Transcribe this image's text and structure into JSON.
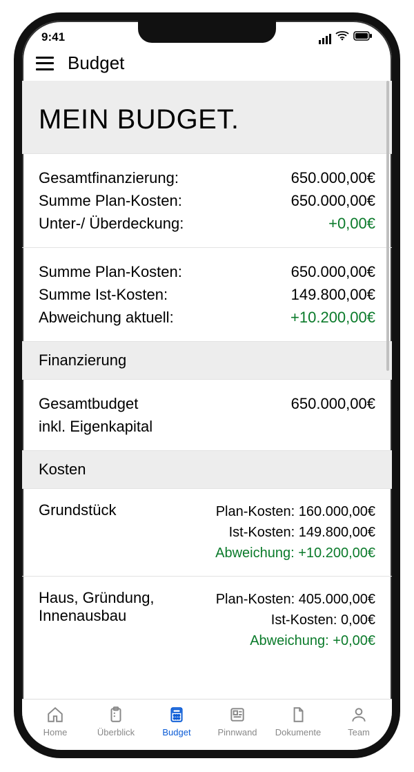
{
  "status": {
    "time": "9:41"
  },
  "nav": {
    "title": "Budget"
  },
  "hero": {
    "title": "MEIN BUDGET."
  },
  "summary1": {
    "r1_label": "Gesamtfinanzierung:",
    "r1_value": "650.000,00€",
    "r2_label": "Summe Plan-Kosten:",
    "r2_value": "650.000,00€",
    "r3_label": "Unter-/ Überdeckung:",
    "r3_value": "+0,00€"
  },
  "summary2": {
    "r1_label": "Summe Plan-Kosten:",
    "r1_value": "650.000,00€",
    "r2_label": "Summe Ist-Kosten:",
    "r2_value": "149.800,00€",
    "r3_label": "Abweichung aktuell:",
    "r3_value": "+10.200,00€"
  },
  "finHeader": "Finanzierung",
  "gesamt": {
    "label_l1": "Gesamtbudget",
    "label_l2": "inkl. Eigenkapital",
    "value": "650.000,00€"
  },
  "kostenHeader": "Kosten",
  "cost1": {
    "title": "Grundstück",
    "r1": "Plan-Kosten: 160.000,00€",
    "r2": "Ist-Kosten: 149.800,00€",
    "r3": "Abweichung: +10.200,00€"
  },
  "cost2": {
    "title_l1": "Haus, Gründung,",
    "title_l2": "Innenausbau",
    "r1": "Plan-Kosten: 405.000,00€",
    "r2": "Ist-Kosten: 0,00€",
    "r3": "Abweichung: +0,00€"
  },
  "tabs": {
    "t0": "Home",
    "t1": "Überblick",
    "t2": "Budget",
    "t3": "Pinnwand",
    "t4": "Dokumente",
    "t5": "Team"
  }
}
